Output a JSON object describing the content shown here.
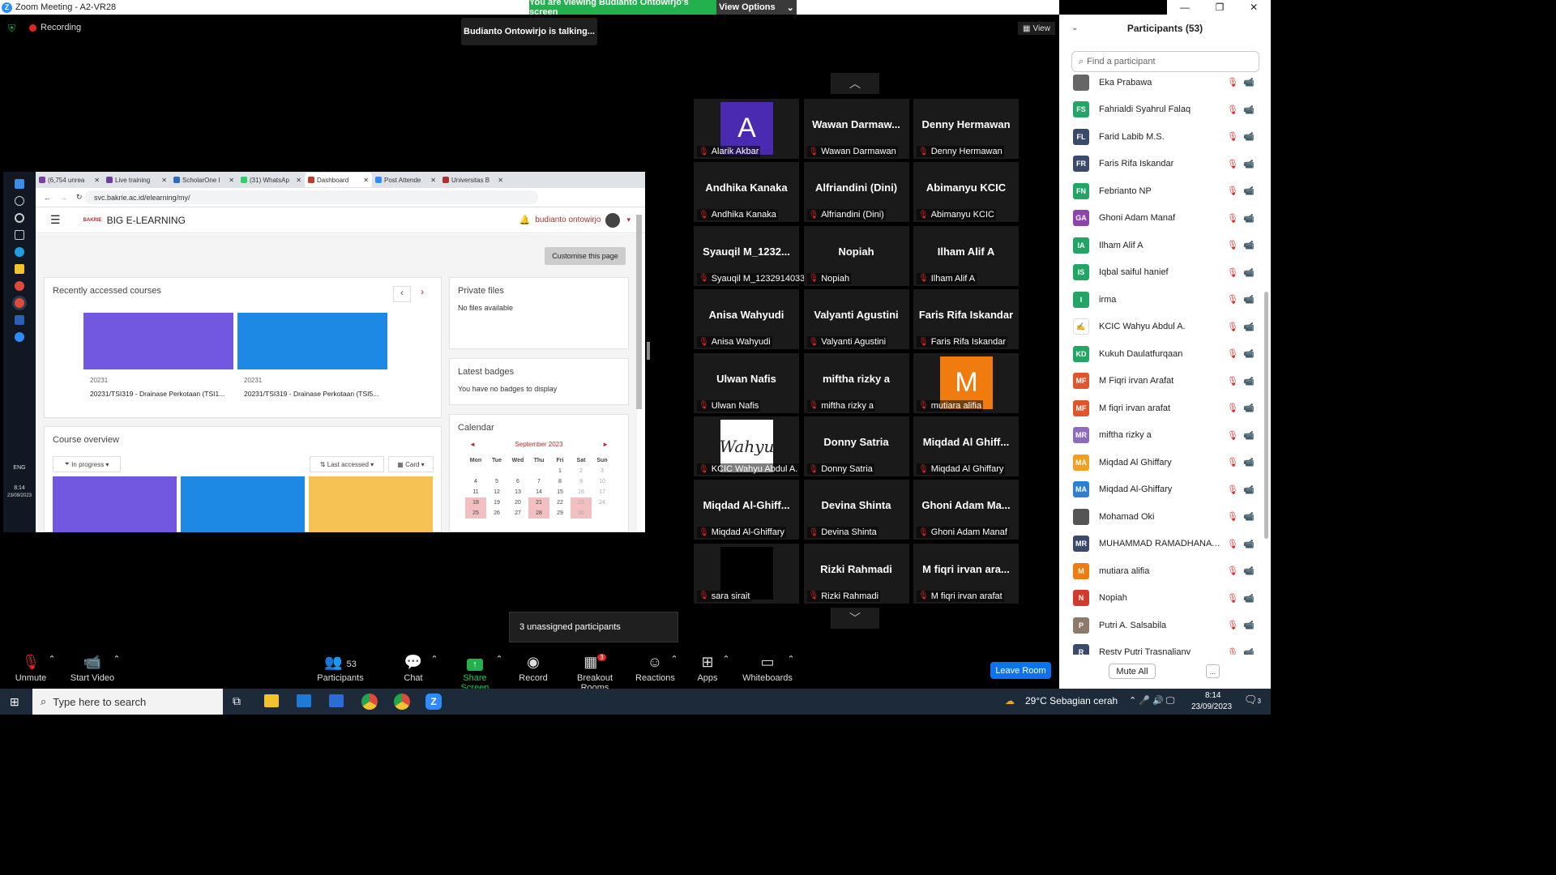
{
  "window": {
    "title": "Zoom Meeting - A2-VR28",
    "viewing_banner": "You are viewing Budianto Ontowirjo's screen",
    "view_options": "View Options"
  },
  "top": {
    "recording": "Recording",
    "talking": "Budianto Ontowirjo is talking...",
    "view": "View"
  },
  "shared_screen": {
    "tabs": [
      {
        "label": "(6,754 unrea",
        "color": "#7b3f9e"
      },
      {
        "label": "Live training",
        "color": "#6a3fa0"
      },
      {
        "label": "ScholarOne I",
        "color": "#2a6bbf"
      },
      {
        "label": "(31) WhatsAp",
        "color": "#25d366"
      },
      {
        "label": "Dashboard",
        "color": "#c0392b"
      },
      {
        "label": "Post Attende",
        "color": "#2d8cff"
      },
      {
        "label": "Universitas B",
        "color": "#b03030"
      }
    ],
    "url": "svc.bakrie.ac.id/elearning/my/",
    "site_logo_text": "BAKRIE",
    "site_name": "BIG E-LEARNING",
    "user_name": "budianto ontowirjo",
    "customise_btn": "Customise this page",
    "recently_accessed": "Recently accessed courses",
    "courses": [
      {
        "code": "20231",
        "title": "20231/TSI319 - Drainase Perkotaan (TSI1...",
        "color": "#7257e0"
      },
      {
        "code": "20231",
        "title": "20231/TSI319 - Drainase Perkotaan (TSI5...",
        "color": "#1e88e5"
      }
    ],
    "private_files": "Private files",
    "no_files": "No files available",
    "latest_badges": "Latest badges",
    "no_badges": "You have no badges to display",
    "calendar_title": "Calendar",
    "calendar_month": "September 2023",
    "calendar_days": [
      "Mon",
      "Tue",
      "Wed",
      "Thu",
      "Fri",
      "Sat",
      "Sun"
    ],
    "calendar_rows": [
      [
        "",
        "",
        "",
        "",
        "1",
        "2",
        "3"
      ],
      [
        "4",
        "5",
        "6",
        "7",
        "8",
        "9",
        "10"
      ],
      [
        "11",
        "12",
        "13",
        "14",
        "15",
        "16",
        "17"
      ],
      [
        "18",
        "19",
        "20",
        "21",
        "22",
        "23",
        "24"
      ],
      [
        "25",
        "26",
        "27",
        "28",
        "29",
        "30",
        ""
      ]
    ],
    "course_overview": "Course overview",
    "filter_progress": "In progress",
    "filter_sort": "Last accessed",
    "filter_view": "Card",
    "clock_time": "8:14",
    "clock_date": "23/09/2023",
    "lang": "ENG"
  },
  "gallery": [
    {
      "big": "A",
      "label": "Alarik Akbar",
      "avatar": "#4a2ab0"
    },
    {
      "big": "Wawan Darmaw...",
      "label": "Wawan Darmawan"
    },
    {
      "big": "Denny Hermawan",
      "label": "Denny Hermawan"
    },
    {
      "big": "Andhika Kanaka",
      "label": "Andhika Kanaka"
    },
    {
      "big": "Alfriandini (Dini)",
      "label": "Alfriandini (Dini)"
    },
    {
      "big": "Abimanyu KCIC",
      "label": "Abimanyu KCIC"
    },
    {
      "big": "Syauqil M_1232...",
      "label": "Syauqil M_1232914033"
    },
    {
      "big": "Nopiah",
      "label": "Nopiah"
    },
    {
      "big": "Ilham Alif A",
      "label": "Ilham Alif A"
    },
    {
      "big": "Anisa Wahyudi",
      "label": "Anisa Wahyudi"
    },
    {
      "big": "Valyanti Agustini",
      "label": "Valyanti Agustini"
    },
    {
      "big": "Faris Rifa Iskandar",
      "label": "Faris Rifa Iskandar"
    },
    {
      "big": "Ulwan Nafis",
      "label": "Ulwan Nafis"
    },
    {
      "big": "miftha rizky a",
      "label": "miftha rizky a"
    },
    {
      "big": "M",
      "label": "mutiara alifia",
      "avatar": "#f07c10"
    },
    {
      "big": "Wahyu",
      "label": "KCIC Wahyu Abdul A.",
      "avatar": "#ffffff"
    },
    {
      "big": "Donny Satria",
      "label": "Donny Satria"
    },
    {
      "big": "Miqdad Al Ghiff...",
      "label": "Miqdad Al Ghiffary"
    },
    {
      "big": "Miqdad Al-Ghiff...",
      "label": "Miqdad Al-Ghiffary"
    },
    {
      "big": "Devina Shinta",
      "label": "Devina Shinta"
    },
    {
      "big": "Ghoni Adam Ma...",
      "label": "Ghoni Adam Manaf"
    },
    {
      "big": "",
      "label": "sara sirait",
      "avatar": "#000000"
    },
    {
      "big": "Rizki Rahmadi",
      "label": "Rizki Rahmadi"
    },
    {
      "big": "M fiqri irvan ara...",
      "label": "M fiqri irvan arafat"
    }
  ],
  "unassigned": "3 unassigned participants",
  "toolbar": {
    "unmute": "Unmute",
    "start_video": "Start Video",
    "participants": "Participants",
    "participants_count": "53",
    "chat": "Chat",
    "share_screen": "Share Screen",
    "record": "Record",
    "breakout": "Breakout Rooms",
    "breakout_badge": "3",
    "reactions": "Reactions",
    "apps": "Apps",
    "whiteboards": "Whiteboards",
    "leave": "Leave Room"
  },
  "panel": {
    "title": "Participants (53)",
    "search_placeholder": "Find a participant",
    "mute_all": "Mute All",
    "more": "...",
    "participants": [
      {
        "initials": "",
        "name": "Eka Prabawa",
        "color": "#666666"
      },
      {
        "initials": "FS",
        "name": "Fahrialdi Syahrul Falaq",
        "color": "#23a566"
      },
      {
        "initials": "FL",
        "name": "Farid Labib M.S.",
        "color": "#3b4a6b"
      },
      {
        "initials": "FR",
        "name": "Faris Rifa Iskandar",
        "color": "#3b4a6b"
      },
      {
        "initials": "FN",
        "name": "Febrianto NP",
        "color": "#23a566"
      },
      {
        "initials": "GA",
        "name": "Ghoni Adam Manaf",
        "color": "#8e44ad"
      },
      {
        "initials": "IA",
        "name": "Ilham Alif A",
        "color": "#23a566"
      },
      {
        "initials": "IS",
        "name": "Iqbal saiful hanief",
        "color": "#23a566"
      },
      {
        "initials": "I",
        "name": "irma",
        "color": "#23a566"
      },
      {
        "initials": "",
        "name": "KCIC Wahyu Abdul A.",
        "color": "#ffffff"
      },
      {
        "initials": "KD",
        "name": "Kukuh Daulatfurqaan",
        "color": "#23a566"
      },
      {
        "initials": "MF",
        "name": "M Fiqri irvan Arafat",
        "color": "#e0552b"
      },
      {
        "initials": "MF",
        "name": "M fiqri irvan arafat",
        "color": "#e0552b"
      },
      {
        "initials": "MR",
        "name": "miftha rizky a",
        "color": "#8e6bbf"
      },
      {
        "initials": "MA",
        "name": "Miqdad Al Ghiffary",
        "color": "#f0a020"
      },
      {
        "initials": "MA",
        "name": "Miqdad Al-Ghiffary",
        "color": "#2d7fd6"
      },
      {
        "initials": "",
        "name": "Mohamad Oki",
        "color": "#555555"
      },
      {
        "initials": "MR",
        "name": "MUHAMMAD RAMADHANA R...",
        "color": "#3b4a6b"
      },
      {
        "initials": "M",
        "name": "mutiara alifia",
        "color": "#f07c10"
      },
      {
        "initials": "N",
        "name": "Nopiah",
        "color": "#d23b2b"
      },
      {
        "initials": "P",
        "name": "Putri A. Salsabila",
        "color": "#8e7a6a"
      },
      {
        "initials": "R",
        "name": "Resty Putri Trasnaliany",
        "color": "#3b4a6b"
      }
    ]
  },
  "taskbar": {
    "search": "Type here to search",
    "weather": "29°C  Sebagian cerah",
    "time": "8:14",
    "date": "23/09/2023",
    "notif_count": "3"
  }
}
